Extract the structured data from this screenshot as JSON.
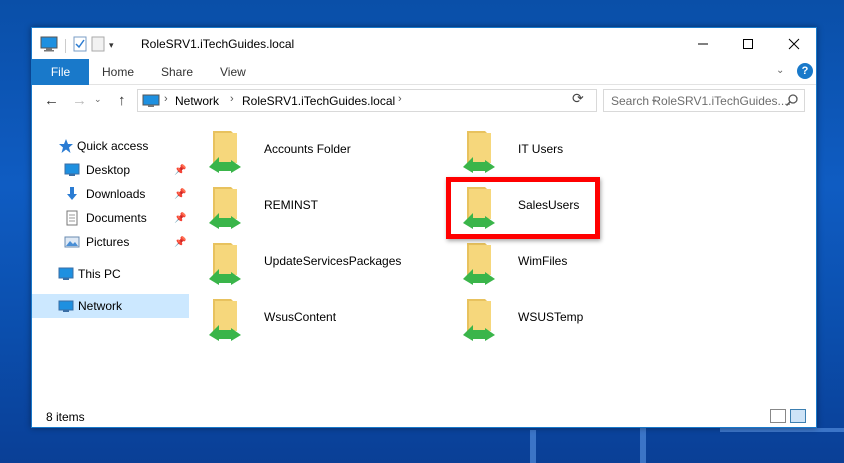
{
  "window": {
    "title": "RoleSRV1.iTechGuides.local",
    "minimize": "—",
    "maximize": "☐",
    "close": "✕"
  },
  "ribbon": {
    "tabs": [
      "File",
      "Home",
      "Share",
      "View"
    ],
    "help": "?"
  },
  "address": {
    "crumbs": [
      "Network",
      "RoleSRV1.iTechGuides.local"
    ],
    "search_placeholder": "Search RoleSRV1.iTechGuides...."
  },
  "nav": {
    "quick_access": "Quick access",
    "pinned": [
      "Desktop",
      "Downloads",
      "Documents",
      "Pictures"
    ],
    "this_pc": "This PC",
    "network": "Network"
  },
  "items": [
    "Accounts Folder",
    "IT Users",
    "REMINST",
    "SalesUsers",
    "UpdateServicesPackages",
    "WimFiles",
    "WsusContent",
    "WSUSTemp"
  ],
  "status": {
    "count": "8 items"
  },
  "colors": {
    "accent": "#1979ca",
    "highlight": "#ff0000",
    "selected_nav": "#cce8ff",
    "folder": "#f6d77c",
    "share_arrow": "#3ab54a"
  }
}
